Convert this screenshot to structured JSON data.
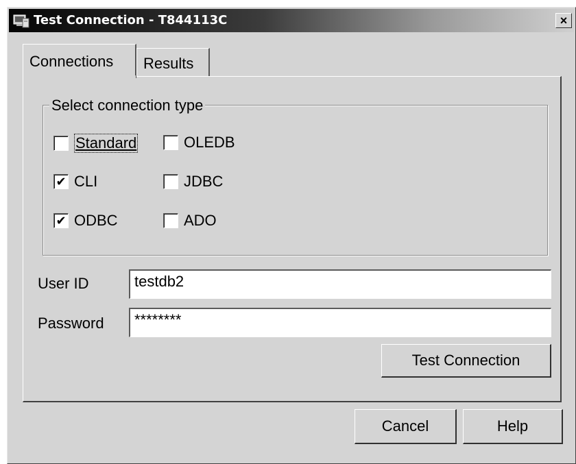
{
  "window": {
    "title": "Test Connection - T844113C",
    "close_label": "×"
  },
  "tabs": [
    {
      "label": "Connections",
      "selected": true
    },
    {
      "label": "Results",
      "selected": false
    }
  ],
  "connection_type": {
    "group_title": "Select connection type",
    "options": [
      {
        "label": "Standard",
        "checked": false,
        "mark": ""
      },
      {
        "label": "OLEDB",
        "checked": false,
        "mark": ""
      },
      {
        "label": "CLI",
        "checked": true,
        "mark": "✔"
      },
      {
        "label": "JDBC",
        "checked": false,
        "mark": ""
      },
      {
        "label": "ODBC",
        "checked": true,
        "mark": "✔"
      },
      {
        "label": "ADO",
        "checked": false,
        "mark": ""
      }
    ]
  },
  "form": {
    "user_id_label": "User ID",
    "user_id_value": "testdb2",
    "password_label": "Password",
    "password_value": "********"
  },
  "buttons": {
    "test_connection": "Test Connection",
    "cancel": "Cancel",
    "help": "Help"
  },
  "icons": {
    "app": "computer-window-icon",
    "close": "close-icon",
    "checkmark": "checkmark-icon"
  }
}
